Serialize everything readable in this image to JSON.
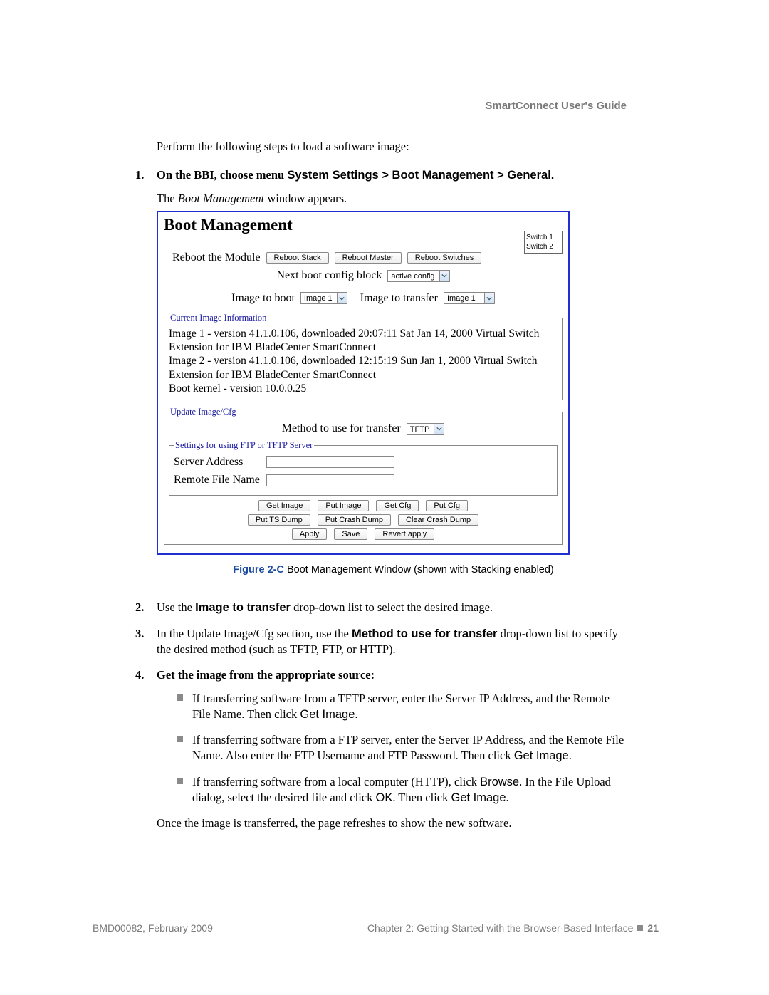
{
  "header": {
    "guide": "SmartConnect User's Guide"
  },
  "intro": "Perform the following steps to load a software image:",
  "steps": {
    "s1": {
      "num": "1.",
      "pre": "On the BBI, choose menu ",
      "path": "System Settings > Boot Management > General.",
      "sub_pre": "The ",
      "sub_ital": "Boot Management",
      "sub_post": " window appears."
    },
    "s2": {
      "num": "2.",
      "pre": "Use the ",
      "bold": "Image to transfer",
      "post": " drop-down list to select the desired image."
    },
    "s3": {
      "num": "3.",
      "pre": "In the Update Image/Cfg section, use the ",
      "bold": "Method to use for transfer",
      "post": " drop-down list to specify the desired method (such as TFTP, FTP, or HTTP)."
    },
    "s4": {
      "num": "4.",
      "text": "Get the image from the appropriate source:"
    }
  },
  "panel": {
    "title": "Boot Management",
    "switches": [
      "Switch 1",
      "Switch 2"
    ],
    "reboot_label": "Reboot the Module",
    "btn_reboot_stack": "Reboot Stack",
    "btn_reboot_master": "Reboot Master",
    "btn_reboot_switches": "Reboot Switches",
    "next_block_label": "Next boot config block",
    "next_block_value": "active config",
    "image_boot_label": "Image to boot",
    "image_boot_value": "Image 1",
    "image_transfer_label": "Image to transfer",
    "image_transfer_value": "Image 1",
    "legend_current": "Current Image Information",
    "info_line1": "Image 1 - version 41.1.0.106, downloaded 20:07:11 Sat Jan 14, 2000 Virtual Switch Extension for IBM BladeCenter SmartConnect",
    "info_line2": "Image 2 - version 41.1.0.106, downloaded 12:15:19 Sun Jan 1, 2000 Virtual Switch Extension for IBM BladeCenter SmartConnect",
    "info_line3": "Boot kernel - version 10.0.0.25",
    "legend_update": "Update Image/Cfg",
    "method_label": "Method to use for transfer",
    "method_value": "TFTP",
    "legend_settings": "Settings for using FTP or TFTP Server",
    "server_addr_label": "Server Address",
    "remote_file_label": "Remote File Name",
    "btn_get_image": "Get Image",
    "btn_put_image": "Put Image",
    "btn_get_cfg": "Get Cfg",
    "btn_put_cfg": "Put Cfg",
    "btn_put_ts": "Put TS Dump",
    "btn_put_crash": "Put Crash Dump",
    "btn_clear_crash": "Clear Crash Dump",
    "btn_apply": "Apply",
    "btn_save": "Save",
    "btn_revert": "Revert apply"
  },
  "figure": {
    "num": "Figure 2-C",
    "caption": "  Boot Management Window (shown with Stacking enabled)"
  },
  "bullets": {
    "b1_a": "If transferring software from a TFTP server, enter the Server IP Address, and the Remote File Name. Then click ",
    "b1_b": "Get Image",
    "b1_c": ".",
    "b2_a": "If transferring software from a FTP server, enter the Server IP Address, and the Remote File Name. Also enter the FTP Username and FTP Password. Then click ",
    "b2_b": "Get Image",
    "b2_c": ".",
    "b3_a": "If transferring software from a local computer (HTTP), click ",
    "b3_b": "Browse",
    "b3_c": ". In the File Upload dialog, select the desired file and click ",
    "b3_d": "OK",
    "b3_e": ". Then click ",
    "b3_f": "Get Image",
    "b3_g": "."
  },
  "after": "Once the image is transferred, the page refreshes to show the new software.",
  "footer": {
    "left": "BMD00082, February 2009",
    "right_prefix": "Chapter 2: Getting Started with the Browser-Based Interface",
    "page": "21"
  }
}
